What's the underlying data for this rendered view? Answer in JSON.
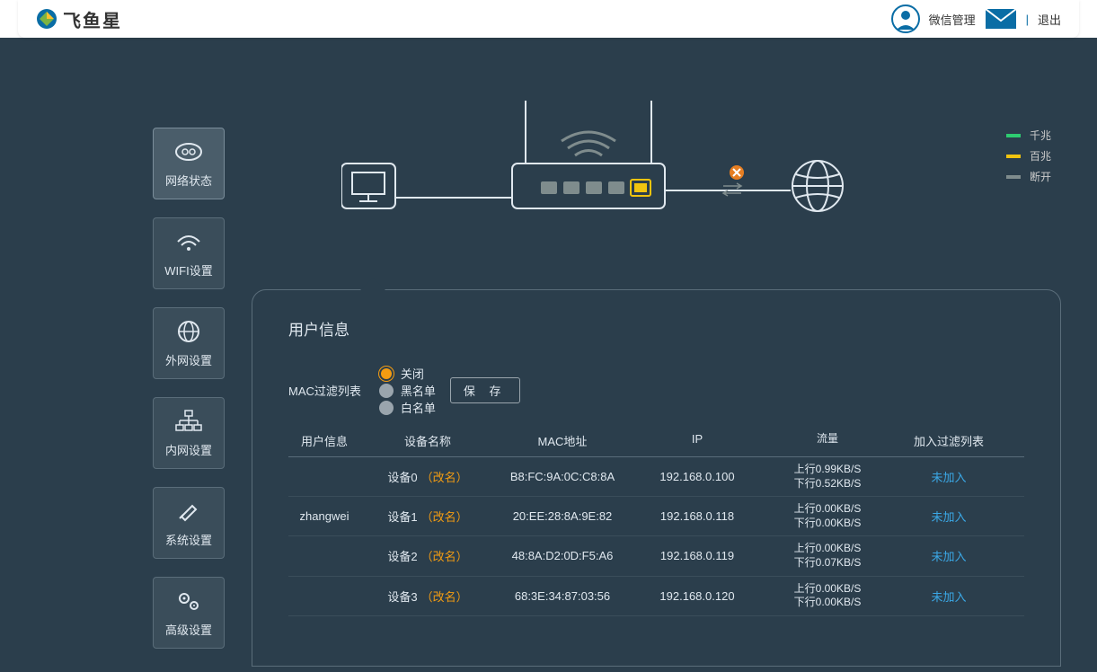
{
  "header": {
    "brand": "飞鱼星",
    "wechat": "微信管理",
    "logout": "退出"
  },
  "nav": [
    {
      "id": "status",
      "label": "网络状态",
      "active": true
    },
    {
      "id": "wifi",
      "label": "WIFI设置",
      "active": false
    },
    {
      "id": "wan",
      "label": "外网设置",
      "active": false
    },
    {
      "id": "lan",
      "label": "内网设置",
      "active": false
    },
    {
      "id": "system",
      "label": "系统设置",
      "active": false
    },
    {
      "id": "advanced",
      "label": "高级设置",
      "active": false
    }
  ],
  "legend": {
    "gigabit": "千兆",
    "hundred": "百兆",
    "disconnected": "断开",
    "colors": {
      "gigabit": "#2ecc71",
      "hundred": "#f1c40f",
      "disconnected": "#7f8c8d"
    }
  },
  "panel": {
    "title": "用户信息",
    "filter": {
      "label": "MAC过滤列表",
      "options": [
        "关闭",
        "黑名单",
        "白名单"
      ],
      "selected": 0,
      "save": "保 存"
    },
    "columns": {
      "user": "用户信息",
      "device": "设备名称",
      "mac": "MAC地址",
      "ip": "IP",
      "traffic": "流量",
      "action": "加入过滤列表"
    },
    "rename": "（改名）",
    "rows": [
      {
        "user": "",
        "device": "设备0",
        "mac": "B8:FC:9A:0C:C8:8A",
        "ip": "192.168.0.100",
        "up": "上行0.99KB/S",
        "down": "下行0.52KB/S",
        "action": "未加入"
      },
      {
        "user": "zhangwei",
        "device": "设备1",
        "mac": "20:EE:28:8A:9E:82",
        "ip": "192.168.0.118",
        "up": "上行0.00KB/S",
        "down": "下行0.00KB/S",
        "action": "未加入"
      },
      {
        "user": "",
        "device": "设备2",
        "mac": "48:8A:D2:0D:F5:A6",
        "ip": "192.168.0.119",
        "up": "上行0.00KB/S",
        "down": "下行0.07KB/S",
        "action": "未加入"
      },
      {
        "user": "",
        "device": "设备3",
        "mac": "68:3E:34:87:03:56",
        "ip": "192.168.0.120",
        "up": "上行0.00KB/S",
        "down": "下行0.00KB/S",
        "action": "未加入"
      }
    ]
  }
}
